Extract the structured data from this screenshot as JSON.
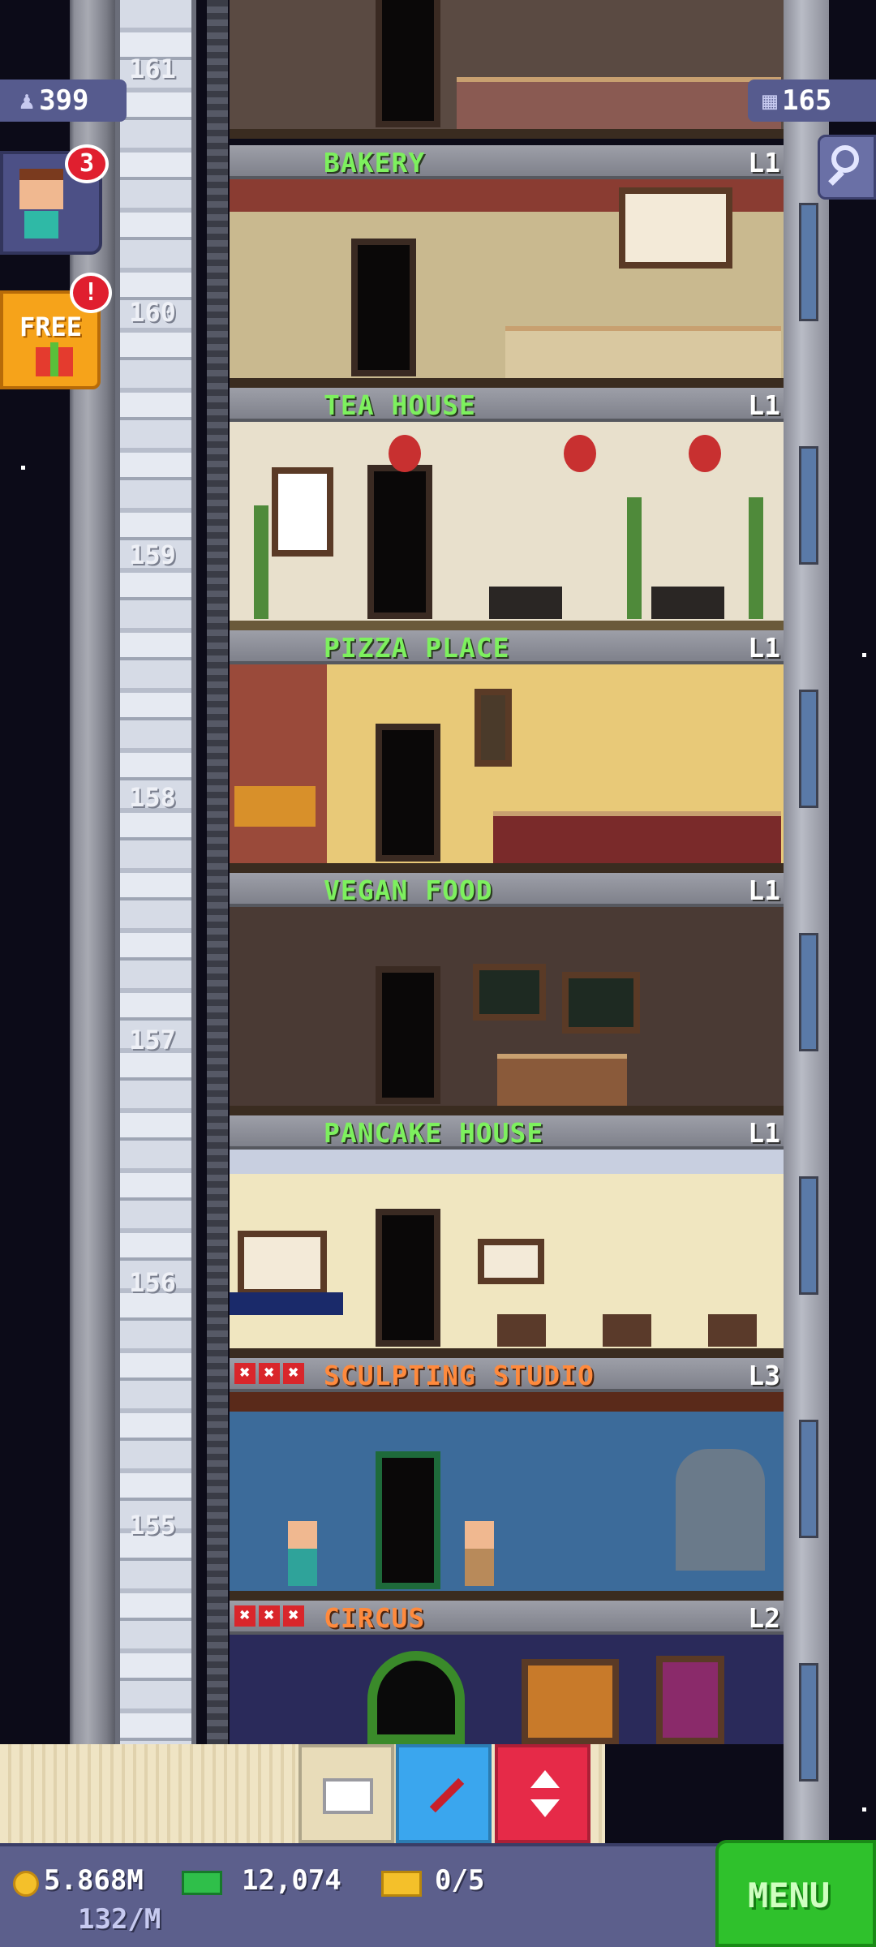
{
  "hud": {
    "population": "399",
    "floor_count": "165",
    "visitor_badge": "3",
    "free_badge": "!",
    "free_label": "FREE"
  },
  "elevator": {
    "floor_numbers": [
      "161",
      "160",
      "159",
      "158",
      "157",
      "156",
      "155"
    ]
  },
  "floors": [
    {
      "name": "BAKERY",
      "level": "L1"
    },
    {
      "name": "TEA HOUSE",
      "level": "L1"
    },
    {
      "name": "PIZZA PLACE",
      "level": "L1"
    },
    {
      "name": "VEGAN FOOD",
      "level": "L1"
    },
    {
      "name": "PANCAKE HOUSE",
      "level": "L1"
    },
    {
      "name": "SCULPTING STUDIO",
      "level": "L3",
      "marks": "✖✖✖"
    },
    {
      "name": "CIRCUS",
      "level": "L2",
      "marks": "✖✖✖"
    }
  ],
  "toolbar": {
    "icons": [
      "box-icon",
      "pin-icon",
      "elevator-arrows-icon"
    ]
  },
  "status": {
    "coins": "5.868M",
    "coins_rate": "132/M",
    "bux": "12,074",
    "tickets": "0/5",
    "menu_label": "MENU"
  },
  "colors": {
    "floor_name_green": "#7df05e",
    "floor_name_orange": "#ff8a3d",
    "menu_green": "#2fc12c",
    "hud_purple": "#565b8e"
  }
}
